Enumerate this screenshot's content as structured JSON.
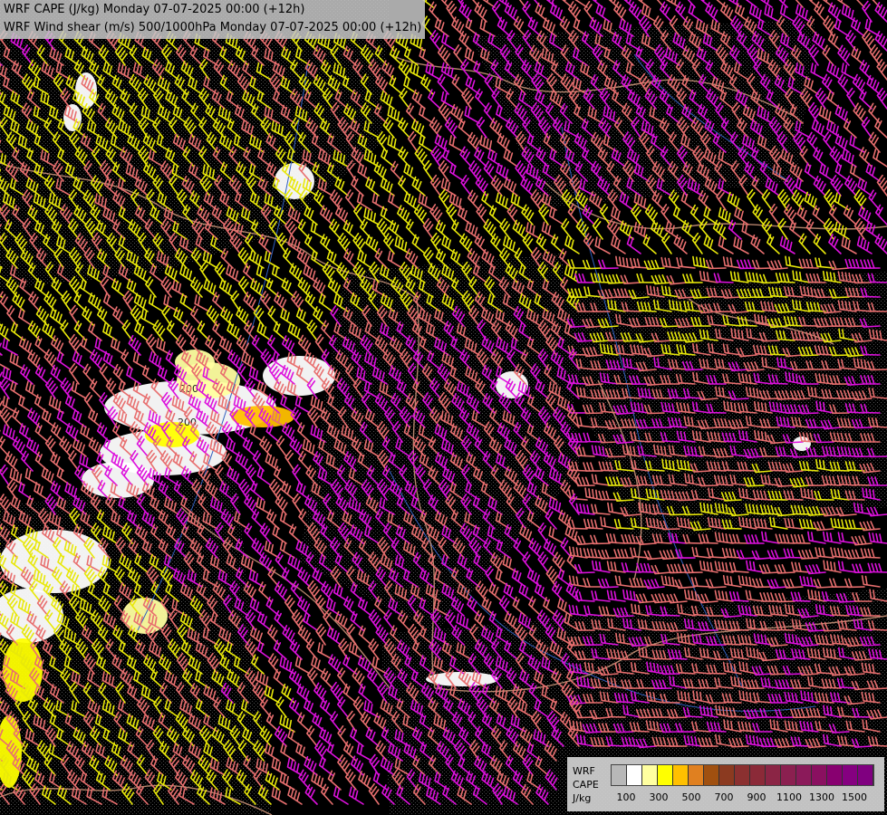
{
  "title": {
    "line1": "WRF CAPE (J/kg) Monday 07-07-2025 00:00 (+12h)",
    "line2": "WRF Wind shear (m/s) 500/1000hPa Monday 07-07-2025 00:00 (+12h)"
  },
  "map": {
    "background_color": "#000000",
    "contour_label": "200",
    "barb_colors": {
      "low": "#e8e80a",
      "mid": "#e86f6f",
      "high": "#dd11dd"
    },
    "border_colors": {
      "country": "#d49a7e",
      "river": "#3060c0"
    }
  },
  "legend": {
    "label_line1": "WRF",
    "label_line2": "CAPE",
    "label_line3": "J/kg",
    "colors": [
      "#b8b8b8",
      "#ffffff",
      "#ffffa0",
      "#ffff00",
      "#ffc000",
      "#e08020",
      "#a05010",
      "#8b3a20",
      "#8b3030",
      "#8b2a38",
      "#8b2545",
      "#8b2050",
      "#8b1a5a",
      "#8a1060",
      "#880070",
      "#850080",
      "#800080"
    ],
    "ticks": [
      "100",
      "300",
      "500",
      "700",
      "900",
      "1100",
      "1300",
      "1500"
    ]
  }
}
